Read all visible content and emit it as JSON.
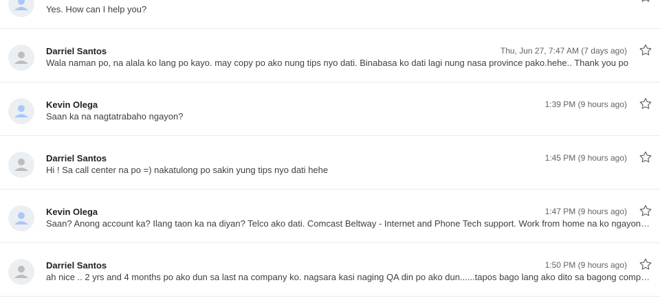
{
  "messages": [
    {
      "sender": "",
      "date": "",
      "snippet": "Yes. How can I help you?",
      "avatar_color": "#a8c7fa"
    },
    {
      "sender": "Darriel Santos",
      "date": "Thu, Jun 27, 7:47 AM (7 days ago)",
      "snippet": "Wala naman po, na alala ko lang po kayo. may copy po ako nung tips nyo dati. Binabasa ko dati lagi nung nasa province pako.hehe.. Thank you po",
      "avatar_color": "#bdbdbd"
    },
    {
      "sender": "Kevin Olega",
      "date": "1:39 PM (9 hours ago)",
      "snippet": "Saan ka na nagtatrabaho ngayon?",
      "avatar_color": "#a8c7fa"
    },
    {
      "sender": "Darriel Santos",
      "date": "1:45 PM (9 hours ago)",
      "snippet": "Hi ! Sa call center na po =) nakatulong po sakin yung tips nyo dati hehe",
      "avatar_color": "#bdbdbd"
    },
    {
      "sender": "Kevin Olega",
      "date": "1:47 PM (9 hours ago)",
      "snippet": "Saan? Anong account ka? Ilang taon ka na diyan? Telco ako dati. Comcast Beltway - Internet and Phone Tech support. Work from home na ko ngayon.…",
      "avatar_color": "#a8c7fa"
    },
    {
      "sender": "Darriel Santos",
      "date": "1:50 PM (9 hours ago)",
      "snippet": "ah nice .. 2 yrs and 4 months po ako dun sa last na company ko. nagsara kasi naging QA din po ako dun......tapos bago lang ako dito sa bagong comp…",
      "avatar_color": "#bdbdbd"
    }
  ],
  "icons": {
    "avatar": "person-icon",
    "star": "star-outline-icon"
  },
  "colors": {
    "divider": "#e8eaed",
    "star_outline": "#5f6368"
  }
}
